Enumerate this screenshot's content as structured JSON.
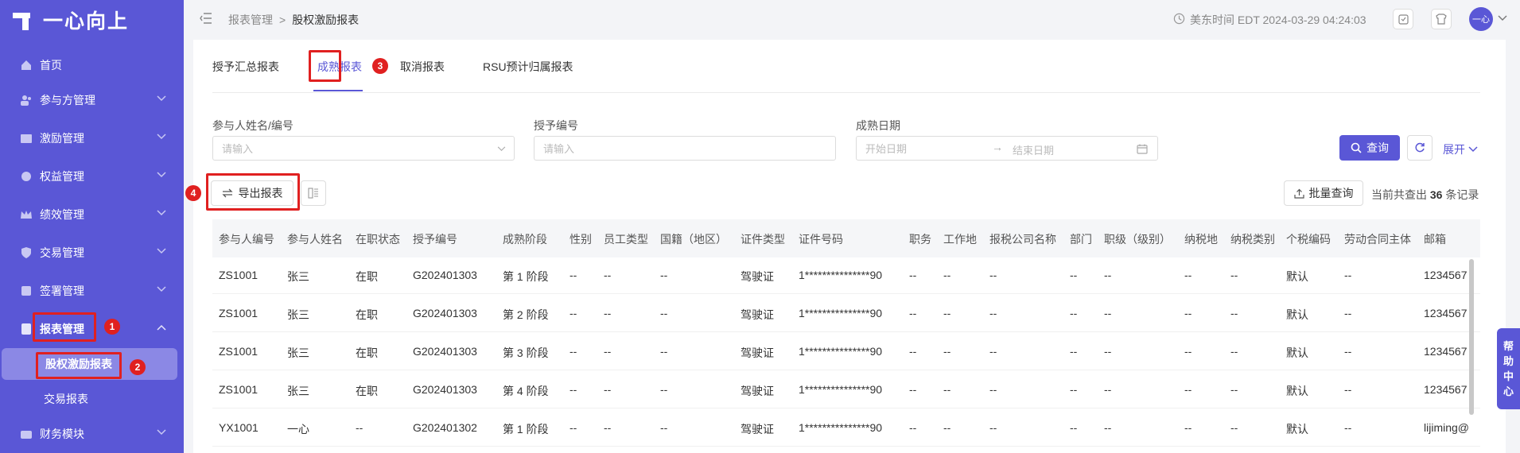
{
  "brand": {
    "logo_text": "一心向上"
  },
  "sidebar": {
    "items": [
      {
        "label": "首页",
        "icon": "home-icon"
      },
      {
        "label": "参与方管理",
        "icon": "people-icon"
      },
      {
        "label": "激励管理",
        "icon": "gift-icon"
      },
      {
        "label": "权益管理",
        "icon": "equity-icon"
      },
      {
        "label": "绩效管理",
        "icon": "crown-icon"
      },
      {
        "label": "交易管理",
        "icon": "shield-icon"
      },
      {
        "label": "签署管理",
        "icon": "sign-icon"
      },
      {
        "label": "报表管理",
        "icon": "report-icon"
      },
      {
        "label": "财务模块",
        "icon": "finance-icon"
      }
    ],
    "sub_items": [
      {
        "label": "股权激励报表"
      },
      {
        "label": "交易报表"
      }
    ]
  },
  "breadcrumb": {
    "parent": "报表管理",
    "separator": ">",
    "current": "股权激励报表"
  },
  "header": {
    "time_label": "美东时间 EDT 2024-03-29 04:24:03",
    "avatar_text": "一心"
  },
  "tabs": [
    {
      "label": "授予汇总报表"
    },
    {
      "label": "成熟报表"
    },
    {
      "label": "取消报表"
    },
    {
      "label": "RSU预计归属报表"
    }
  ],
  "filters": {
    "participant_label": "参与人姓名/编号",
    "participant_placeholder": "请输入",
    "grant_label": "授予编号",
    "grant_placeholder": "请输入",
    "date_label": "成熟日期",
    "start_placeholder": "开始日期",
    "end_placeholder": "结束日期"
  },
  "actions": {
    "query": "查询",
    "expand": "展开",
    "export": "导出报表",
    "batch_query": "批量查询",
    "total_prefix": "当前共查出",
    "total_count": "36",
    "total_suffix": "条记录"
  },
  "annotations": {
    "a1": "1",
    "a2": "2",
    "a3": "3",
    "a4": "4"
  },
  "table": {
    "columns": [
      "参与人编号",
      "参与人姓名",
      "在职状态",
      "授予编号",
      "成熟阶段",
      "性别",
      "员工类型",
      "国籍（地区）",
      "证件类型",
      "证件号码",
      "职务",
      "工作地",
      "报税公司名称",
      "部门",
      "职级（级别）",
      "纳税地",
      "纳税类别",
      "个税编码",
      "劳动合同主体",
      "邮箱"
    ],
    "rows": [
      [
        "ZS1001",
        "张三",
        "在职",
        "G202401303",
        "第 1 阶段",
        "--",
        "--",
        "--",
        "驾驶证",
        "1***************90",
        "--",
        "--",
        "--",
        "--",
        "--",
        "--",
        "--",
        "默认",
        "--",
        "1234567"
      ],
      [
        "ZS1001",
        "张三",
        "在职",
        "G202401303",
        "第 2 阶段",
        "--",
        "--",
        "--",
        "驾驶证",
        "1***************90",
        "--",
        "--",
        "--",
        "--",
        "--",
        "--",
        "--",
        "默认",
        "--",
        "1234567"
      ],
      [
        "ZS1001",
        "张三",
        "在职",
        "G202401303",
        "第 3 阶段",
        "--",
        "--",
        "--",
        "驾驶证",
        "1***************90",
        "--",
        "--",
        "--",
        "--",
        "--",
        "--",
        "--",
        "默认",
        "--",
        "1234567"
      ],
      [
        "ZS1001",
        "张三",
        "在职",
        "G202401303",
        "第 4 阶段",
        "--",
        "--",
        "--",
        "驾驶证",
        "1***************90",
        "--",
        "--",
        "--",
        "--",
        "--",
        "--",
        "--",
        "默认",
        "--",
        "1234567"
      ],
      [
        "YX1001",
        "一心",
        "--",
        "G202401302",
        "第 1 阶段",
        "--",
        "--",
        "--",
        "驾驶证",
        "1***************90",
        "--",
        "--",
        "--",
        "--",
        "--",
        "--",
        "--",
        "默认",
        "--",
        "lijiming@"
      ]
    ]
  },
  "help": {
    "chars": [
      "帮",
      "助",
      "中",
      "心"
    ]
  },
  "colors": {
    "brand": "#5a57d6",
    "annotation": "#e02020"
  }
}
